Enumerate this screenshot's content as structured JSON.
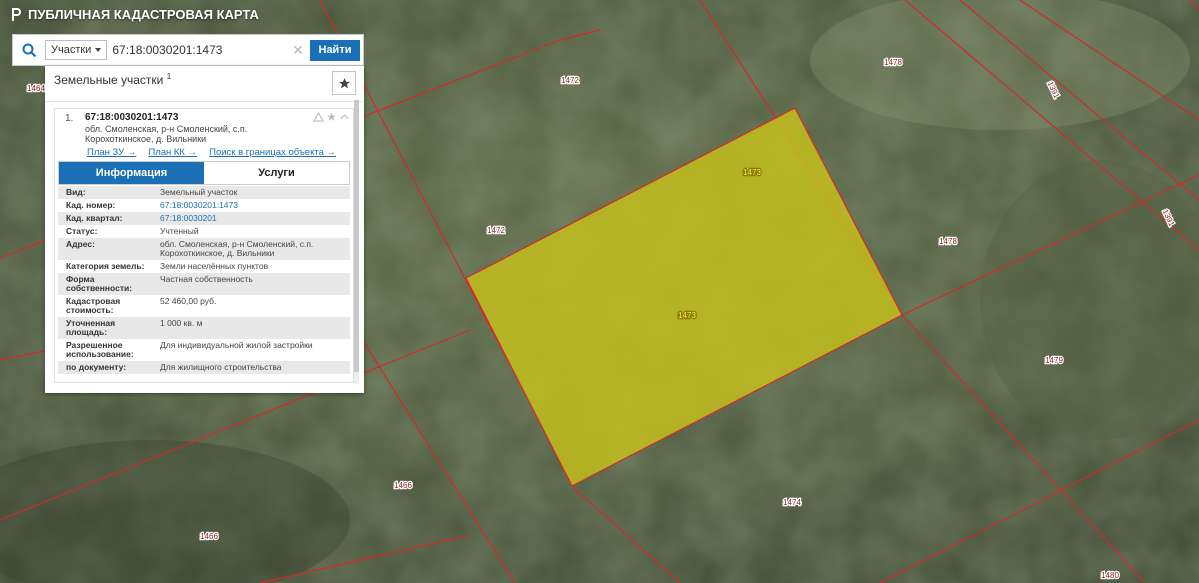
{
  "app": {
    "title": "ПУБЛИЧНАЯ КАДАСТРОВАЯ КАРТА"
  },
  "search": {
    "type_label": "Участки",
    "value": "67:18:0030201:1473",
    "button_label": "Найти"
  },
  "panel": {
    "title": "Земельные участки",
    "count": "1",
    "item": {
      "index": "1.",
      "cad_number": "67:18:0030201:1473",
      "address": "обл. Смоленская, р-н Смоленский, с.п. Корохоткинское, д. Вильники",
      "links": [
        "План ЗУ →",
        "План КК →",
        "Поиск в границах объекта →"
      ],
      "tabs": [
        "Информация",
        "Услуги"
      ],
      "rows": [
        {
          "label": "Вид:",
          "value": "Земельный участок"
        },
        {
          "label": "Кад. номер:",
          "value": "67:18:0030201:1473"
        },
        {
          "label": "Кад. квартал:",
          "value": "67:18:0030201"
        },
        {
          "label": "Статус:",
          "value": "Учтенный"
        },
        {
          "label": "Адрес:",
          "value": "обл. Смоленская, р-н Смоленский, с.п. Корохоткинское, д. Вильники"
        },
        {
          "label": "Категория земель:",
          "value": "Земли населённых пунктов"
        },
        {
          "label": "Форма собственности:",
          "value": "Частная собственность"
        },
        {
          "label": "Кадастровая стоимость:",
          "value": "52 460,00 руб."
        },
        {
          "label": "Уточненная площадь:",
          "value": "1 000 кв. м"
        },
        {
          "label": "Разрешенное использование:",
          "value": "Для индивидуальной жилой застройки"
        },
        {
          "label": "по документу:",
          "value": "Для жилищного строительства"
        }
      ]
    }
  },
  "map": {
    "parcel_labels": [
      "1464",
      "1472",
      "1478",
      "1391",
      "1473",
      "1472",
      "1478",
      "1391",
      "1473",
      "1479",
      "1466",
      "1474",
      "1466",
      "1480"
    ],
    "colors": {
      "selected_fill": "#c9c31a",
      "boundary": "#d12a2a",
      "label_bg": "#ffffff"
    }
  }
}
